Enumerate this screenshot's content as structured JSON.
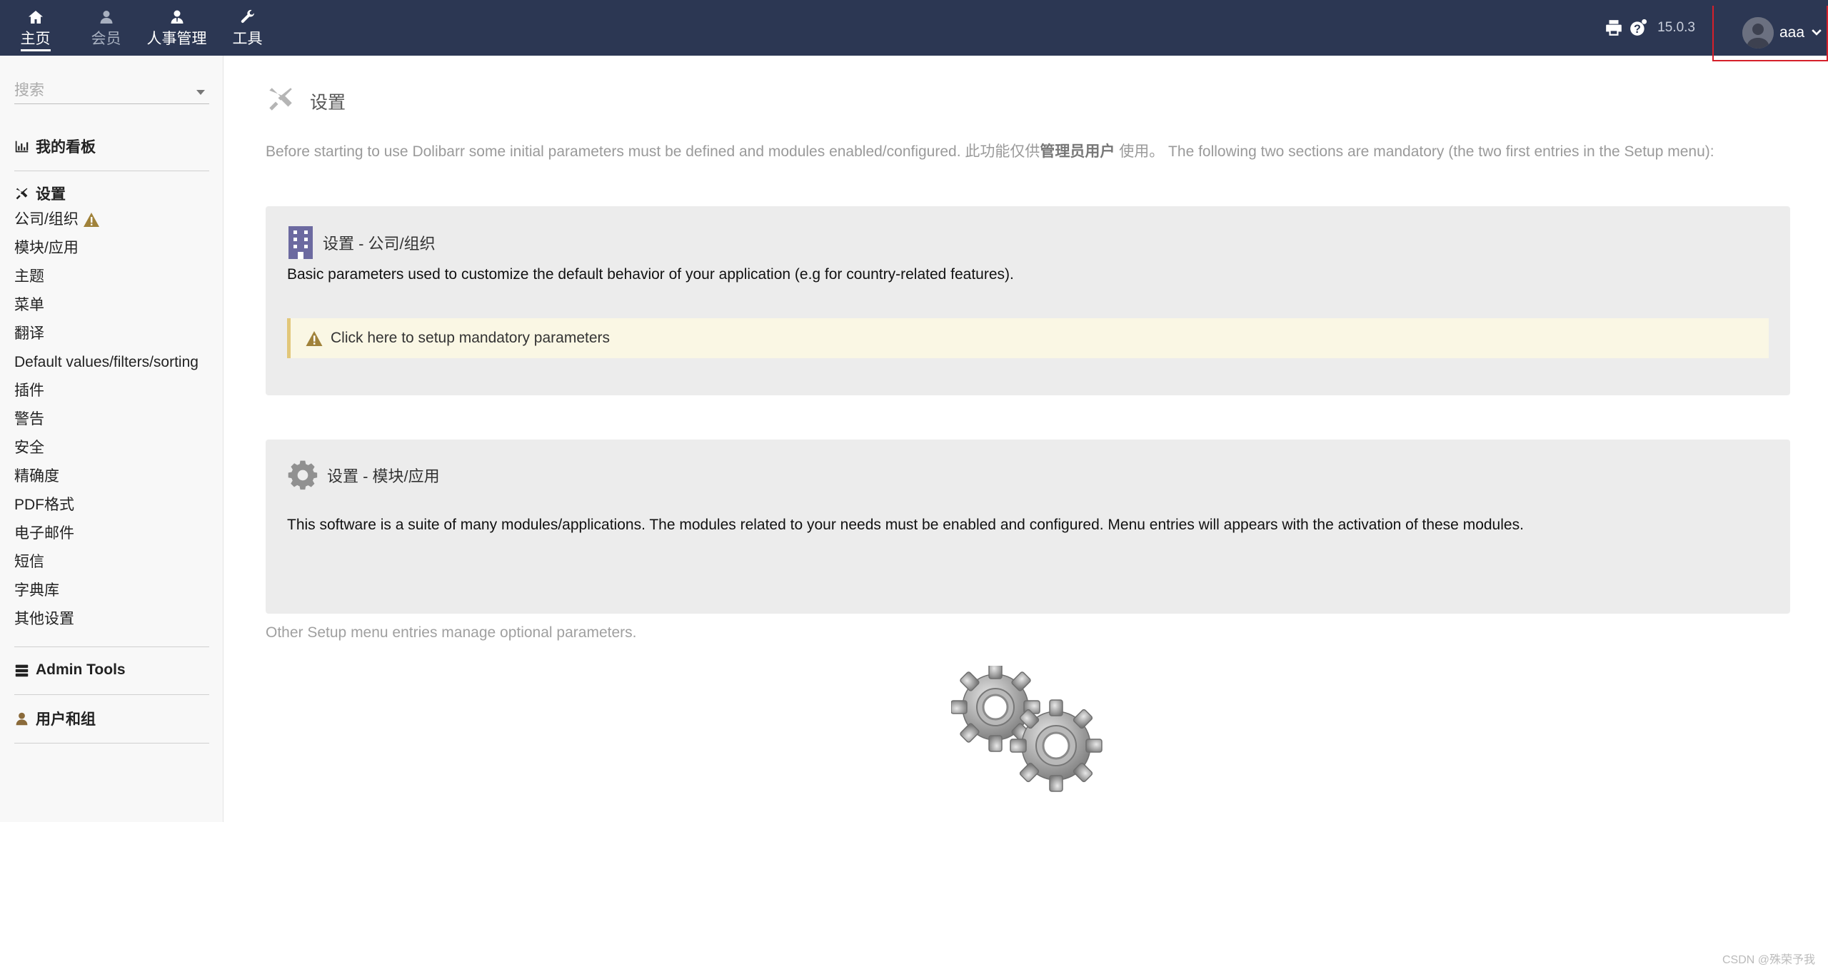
{
  "topnav": {
    "items": [
      {
        "label": "主页",
        "icon": "home-icon",
        "active": true
      },
      {
        "label": "会员",
        "icon": "member-icon"
      },
      {
        "label": "人事管理",
        "icon": "hrm-icon"
      },
      {
        "label": "工具",
        "icon": "wrench-icon"
      }
    ]
  },
  "topright": {
    "version": "15.0.3",
    "username": "aaa"
  },
  "sidebar": {
    "search_placeholder": "搜索",
    "dashboard": "我的看板",
    "setup_title": "设置",
    "setup_items": [
      "公司/组织",
      "模块/应用",
      "主题",
      "菜单",
      "翻译",
      "Default values/filters/sorting",
      "插件",
      "警告",
      "安全",
      "精确度",
      "PDF格式",
      "电子邮件",
      "短信",
      "字典库",
      "其他设置"
    ],
    "admin_tools": "Admin Tools",
    "users_groups": "用户和组"
  },
  "main": {
    "title": "设置",
    "intro_before": "Before starting to use Dolibarr some initial parameters must be defined and modules enabled/configured. 此功能仅供",
    "intro_bold": "管理员用户",
    "intro_after": " 使用。  The following two sections are mandatory (the two first entries in the Setup menu):",
    "company_box": {
      "title": "设置 - 公司/组织",
      "text": "Basic parameters used to customize the default behavior of your application (e.g for country-related features).",
      "warning": "Click here to setup mandatory parameters"
    },
    "modules_box": {
      "title": "设置 - 模块/应用",
      "text": "This software is a suite of many modules/applications. The modules related to your needs must be enabled and configured. Menu entries will appears with the activation of these modules."
    },
    "other_text": "Other Setup menu entries manage optional parameters."
  },
  "watermark": "CSDN @殊荣予我",
  "colors": {
    "topbar": "#2c3753",
    "warning": "#a0823a",
    "building": "#6c6aa0",
    "gear": "#909090"
  }
}
